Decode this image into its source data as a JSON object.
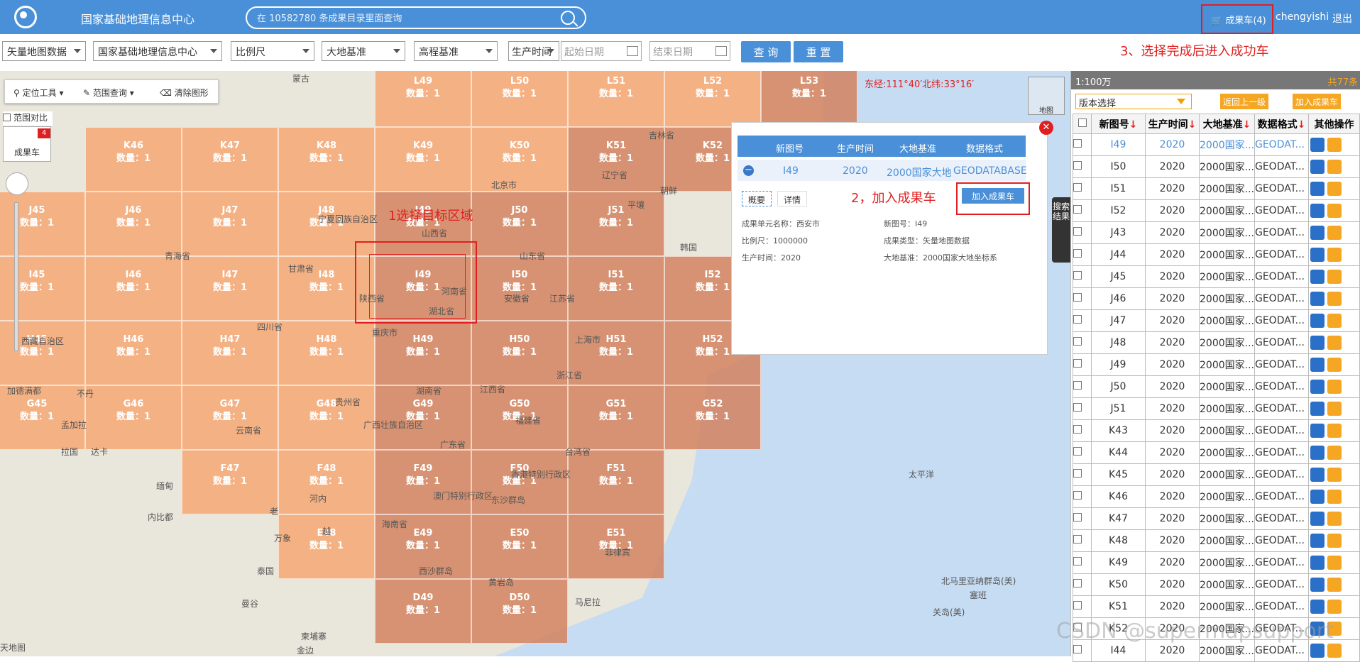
{
  "header": {
    "title": "国家基础地理信息中心",
    "search_placeholder": "在 10582780 条成果目录里面查询",
    "cart": "成果车(4)",
    "user": "chengyishi",
    "logout": "退出"
  },
  "filters": {
    "type": "矢量地图数据",
    "org": "国家基础地理信息中心",
    "scale": "比例尺",
    "datum": "大地基准",
    "height": "高程基准",
    "time_label": "生产时间",
    "start": "起始日期",
    "end": "结束日期",
    "query": "查 询",
    "reset": "重 置"
  },
  "notes": {
    "n1": "1选择目标区域",
    "n2": "2，加入成果车",
    "n3": "3、选择完成后进入成功车"
  },
  "map": {
    "tools": [
      "定位工具",
      "范围查询",
      "清除图形"
    ],
    "compare": "范围对比",
    "cart_label": "成果车",
    "cart_badge": "4",
    "coord": "东经:111°40′北纬:33°16′",
    "minimap": "地图",
    "count_prefix": "数量：",
    "tiles": [
      {
        "id": "L49",
        "n": "1"
      },
      {
        "id": "L50",
        "n": "1"
      },
      {
        "id": "L51",
        "n": "1"
      },
      {
        "id": "L52",
        "n": "1"
      },
      {
        "id": "L53",
        "n": "1"
      },
      {
        "id": "K46",
        "n": "1"
      },
      {
        "id": "K47",
        "n": "1"
      },
      {
        "id": "K48",
        "n": "1"
      },
      {
        "id": "K49",
        "n": "1"
      },
      {
        "id": "K50",
        "n": "1"
      },
      {
        "id": "K51",
        "n": "1"
      },
      {
        "id": "K52",
        "n": "1"
      },
      {
        "id": "J45",
        "n": "1"
      },
      {
        "id": "J46",
        "n": "1"
      },
      {
        "id": "J47",
        "n": "1"
      },
      {
        "id": "J48",
        "n": "1"
      },
      {
        "id": "J49",
        "n": "1"
      },
      {
        "id": "J50",
        "n": "1"
      },
      {
        "id": "J51",
        "n": "1"
      },
      {
        "id": "I45",
        "n": "1"
      },
      {
        "id": "I46",
        "n": "1"
      },
      {
        "id": "I47",
        "n": "1"
      },
      {
        "id": "I48",
        "n": "1"
      },
      {
        "id": "I49",
        "n": "1"
      },
      {
        "id": "I50",
        "n": "1"
      },
      {
        "id": "I51",
        "n": "1"
      },
      {
        "id": "I52",
        "n": "1"
      },
      {
        "id": "H45",
        "n": "1"
      },
      {
        "id": "H46",
        "n": "1"
      },
      {
        "id": "H47",
        "n": "1"
      },
      {
        "id": "H48",
        "n": "1"
      },
      {
        "id": "H49",
        "n": "1"
      },
      {
        "id": "H50",
        "n": "1"
      },
      {
        "id": "H51",
        "n": "1"
      },
      {
        "id": "H52",
        "n": "1"
      },
      {
        "id": "G45",
        "n": "1"
      },
      {
        "id": "G46",
        "n": "1"
      },
      {
        "id": "G47",
        "n": "1"
      },
      {
        "id": "G48",
        "n": "1"
      },
      {
        "id": "G49",
        "n": "1"
      },
      {
        "id": "G50",
        "n": "1"
      },
      {
        "id": "G51",
        "n": "1"
      },
      {
        "id": "G52",
        "n": "1"
      },
      {
        "id": "F47",
        "n": "1"
      },
      {
        "id": "F48",
        "n": "1"
      },
      {
        "id": "F49",
        "n": "1"
      },
      {
        "id": "F50",
        "n": "1"
      },
      {
        "id": "F51",
        "n": "1"
      },
      {
        "id": "E48",
        "n": "1"
      },
      {
        "id": "E49",
        "n": "1"
      },
      {
        "id": "E50",
        "n": "1"
      },
      {
        "id": "E51",
        "n": "1"
      },
      {
        "id": "D49",
        "n": "1"
      },
      {
        "id": "D50",
        "n": "1"
      }
    ],
    "places": [
      "蒙古",
      "吉林省",
      "北京市",
      "朝鲜",
      "山西省",
      "山东省",
      "韩国",
      "青海省",
      "甘肃省",
      "陕西省",
      "河南省",
      "四川省",
      "重庆市",
      "湖北省",
      "安徽省",
      "江苏省",
      "上海市",
      "浙江省",
      "湖南省",
      "江西省",
      "贵州省",
      "福建省",
      "云南省",
      "广西壮族自治区",
      "广东省",
      "台湾省",
      "海南省",
      "缅甸",
      "老",
      "泰国",
      "越",
      "菲律宾",
      "柬埔寨",
      "太平洋",
      "北马里亚纳群岛(美)",
      "关岛(美)",
      "不丹",
      "西藏自治区",
      "宁夏回族自治区",
      "马尼拉",
      "河内",
      "内比都",
      "曼谷",
      "金边",
      "万象",
      "塞班",
      "达卡",
      "澳门特别行政区",
      "香港特别行政区",
      "东沙群岛",
      "西沙群岛",
      "黄岩岛",
      "加德满都",
      "孟加拉",
      "拉国",
      "辽宁省",
      "平壤",
      "天地图"
    ]
  },
  "popup": {
    "headers": [
      "新图号",
      "生产时间",
      "大地基准",
      "数据格式"
    ],
    "row": {
      "id": "I49",
      "time": "2020",
      "datum": "2000国家大地",
      "format": "GEODATABASE"
    },
    "tabs": [
      "概要",
      "详情"
    ],
    "add": "加入成果车",
    "info": {
      "unit": "成果单元名称：西安市",
      "newid": "新图号：I49",
      "scale": "比例尺：1000000",
      "type": "成果类型：矢量地图数据",
      "time": "生产时间：2020",
      "datum": "大地基准：2000国家大地坐标系"
    }
  },
  "side_tab": "搜索结果",
  "panel": {
    "title": "1:100万",
    "total": "共77条",
    "version": "版本选择",
    "back": "返回上一级",
    "add": "加入成果车",
    "columns": [
      "新图号",
      "生产时间",
      "大地基准",
      "数据格式",
      "其他操作"
    ],
    "rows": [
      {
        "id": "I49",
        "time": "2020",
        "datum": "2000国家...",
        "format": "GEODAT...",
        "hl": true
      },
      {
        "id": "I50",
        "time": "2020",
        "datum": "2000国家...",
        "format": "GEODAT..."
      },
      {
        "id": "I51",
        "time": "2020",
        "datum": "2000国家...",
        "format": "GEODAT..."
      },
      {
        "id": "I52",
        "time": "2020",
        "datum": "2000国家...",
        "format": "GEODAT..."
      },
      {
        "id": "J43",
        "time": "2020",
        "datum": "2000国家...",
        "format": "GEODAT..."
      },
      {
        "id": "J44",
        "time": "2020",
        "datum": "2000国家...",
        "format": "GEODAT..."
      },
      {
        "id": "J45",
        "time": "2020",
        "datum": "2000国家...",
        "format": "GEODAT..."
      },
      {
        "id": "J46",
        "time": "2020",
        "datum": "2000国家...",
        "format": "GEODAT..."
      },
      {
        "id": "J47",
        "time": "2020",
        "datum": "2000国家...",
        "format": "GEODAT..."
      },
      {
        "id": "J48",
        "time": "2020",
        "datum": "2000国家...",
        "format": "GEODAT..."
      },
      {
        "id": "J49",
        "time": "2020",
        "datum": "2000国家...",
        "format": "GEODAT..."
      },
      {
        "id": "J50",
        "time": "2020",
        "datum": "2000国家...",
        "format": "GEODAT..."
      },
      {
        "id": "J51",
        "time": "2020",
        "datum": "2000国家...",
        "format": "GEODAT..."
      },
      {
        "id": "K43",
        "time": "2020",
        "datum": "2000国家...",
        "format": "GEODAT..."
      },
      {
        "id": "K44",
        "time": "2020",
        "datum": "2000国家...",
        "format": "GEODAT..."
      },
      {
        "id": "K45",
        "time": "2020",
        "datum": "2000国家...",
        "format": "GEODAT..."
      },
      {
        "id": "K46",
        "time": "2020",
        "datum": "2000国家...",
        "format": "GEODAT..."
      },
      {
        "id": "K47",
        "time": "2020",
        "datum": "2000国家...",
        "format": "GEODAT..."
      },
      {
        "id": "K48",
        "time": "2020",
        "datum": "2000国家...",
        "format": "GEODAT..."
      },
      {
        "id": "K49",
        "time": "2020",
        "datum": "2000国家...",
        "format": "GEODAT..."
      },
      {
        "id": "K50",
        "time": "2020",
        "datum": "2000国家...",
        "format": "GEODAT..."
      },
      {
        "id": "K51",
        "time": "2020",
        "datum": "2000国家...",
        "format": "GEODAT..."
      },
      {
        "id": "K52",
        "time": "2020",
        "datum": "2000国家...",
        "format": "GEODAT..."
      },
      {
        "id": "I44",
        "time": "2020",
        "datum": "2000国家...",
        "format": "GEODAT..."
      }
    ]
  },
  "watermark": "CSDN @supermapsupport",
  "colors": {
    "brand": "#4a90d8",
    "tile": "#f6a773",
    "highlight": "#e02020",
    "orange": "#f5a623"
  }
}
